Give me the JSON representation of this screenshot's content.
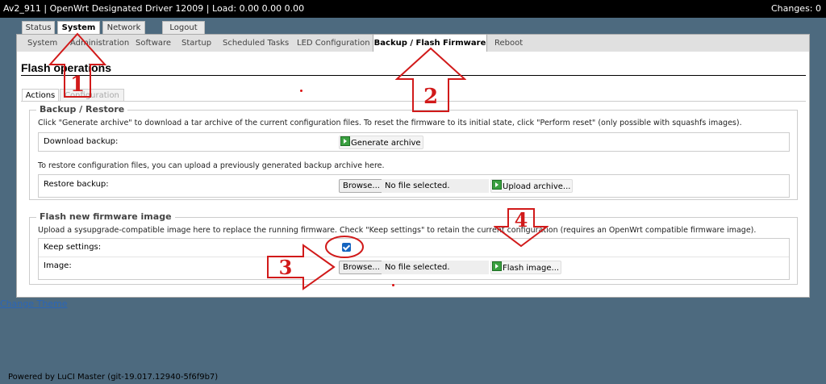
{
  "header": {
    "hostname": "Av2_911",
    "description": "OpenWrt Designated Driver 12009",
    "load": "Load: 0.00 0.00 0.00",
    "changes": "Changes: 0"
  },
  "main_tabs": [
    "Status",
    "System",
    "Network",
    "Logout"
  ],
  "sub_tabs": [
    "System",
    "Administration",
    "Software",
    "Startup",
    "Scheduled Tasks",
    "LED Configuration",
    "Backup / Flash Firmware",
    "Reboot"
  ],
  "page": {
    "title": "Flash operations",
    "content_tabs": [
      "Actions",
      "Configuration"
    ]
  },
  "backup": {
    "legend": "Backup / Restore",
    "description": "Click \"Generate archive\" to download a tar archive of the current configuration files. To reset the firmware to its initial state, click \"Perform reset\" (only possible with squashfs images).",
    "download_label": "Download backup:",
    "generate_button": "Generate archive",
    "restore_description": "To restore configuration files, you can upload a previously generated backup archive here.",
    "restore_label": "Restore backup:",
    "browse_button": "Browse...",
    "file_status": "No file selected.",
    "upload_button": "Upload archive..."
  },
  "flash": {
    "legend": "Flash new firmware image",
    "description": "Upload a sysupgrade-compatible image here to replace the running firmware. Check \"Keep settings\" to retain the current configuration (requires an OpenWrt compatible firmware image).",
    "keep_label": "Keep settings:",
    "keep_checked": true,
    "image_label": "Image:",
    "browse_button": "Browse...",
    "file_status": "No file selected.",
    "flash_button": "Flash image..."
  },
  "theme_link": "Change Theme",
  "footer": "Powered by LuCI Master (git-19.017.12940-5f6f9b7)",
  "annotations": [
    "1",
    "2",
    "3",
    "4"
  ],
  "colors": {
    "annotation": "#d11a1a",
    "background": "#4d6a7f",
    "link": "#2a66b8",
    "checkbox": "#1565c0"
  }
}
